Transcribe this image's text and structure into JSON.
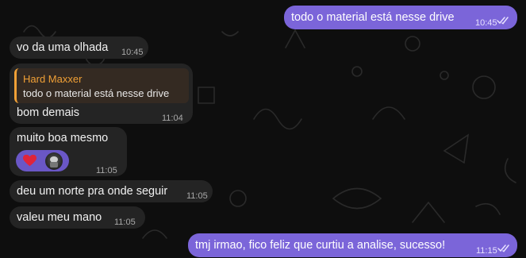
{
  "chat": {
    "messages": [
      {
        "id": "m1",
        "direction": "outgoing",
        "text": "todo o material está nesse drive",
        "time": "10:45",
        "read": true
      },
      {
        "id": "m2",
        "direction": "incoming",
        "text": "vo da uma olhada",
        "time": "10:45"
      },
      {
        "id": "m3",
        "direction": "incoming",
        "reply_to": {
          "author": "Hard Maxxer",
          "text": "todo o material está nesse drive"
        },
        "text": "bom demais",
        "time": "11:04"
      },
      {
        "id": "m4",
        "direction": "incoming",
        "text": "muito boa mesmo",
        "time": "11:05",
        "reactions": [
          "heart-icon",
          "user-avatar"
        ]
      },
      {
        "id": "m5",
        "direction": "incoming",
        "text": "deu um norte pra onde seguir",
        "time": "11:05"
      },
      {
        "id": "m6",
        "direction": "incoming",
        "text": "valeu meu mano",
        "time": "11:05"
      },
      {
        "id": "m7",
        "direction": "outgoing",
        "text": "tmj irmao, fico feliz que curtiu a analise, sucesso!",
        "time": "11:15",
        "read": true
      }
    ]
  },
  "colors": {
    "background": "#0e0e0e",
    "incoming_bubble": "#242424",
    "outgoing_bubble": "#7b65d9",
    "reply_accent": "#f0a036",
    "reaction_bg": "#6a57c6",
    "heart": "#e0243a"
  }
}
